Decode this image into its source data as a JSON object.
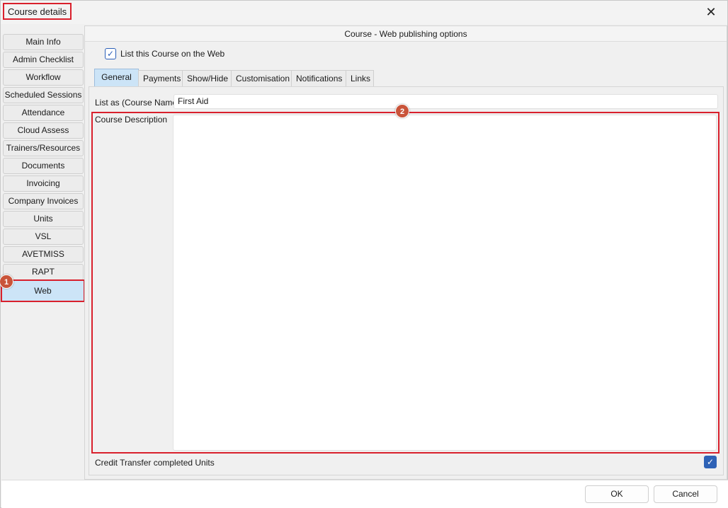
{
  "window": {
    "title": "Course details",
    "close_icon": "close-icon",
    "close_glyph": "✕"
  },
  "sidebar": {
    "items": [
      {
        "label": "Main Info"
      },
      {
        "label": "Admin Checklist"
      },
      {
        "label": "Workflow"
      },
      {
        "label": "Scheduled Sessions"
      },
      {
        "label": "Attendance"
      },
      {
        "label": "Cloud Assess"
      },
      {
        "label": "Trainers/Resources"
      },
      {
        "label": "Documents"
      },
      {
        "label": "Invoicing"
      },
      {
        "label": "Company Invoices"
      },
      {
        "label": "Units"
      },
      {
        "label": "VSL"
      },
      {
        "label": "AVETMISS"
      },
      {
        "label": "RAPT"
      },
      {
        "label": "Web",
        "active": true
      }
    ]
  },
  "markers": {
    "one": "1",
    "two": "2"
  },
  "panel": {
    "title": "Course - Web publishing options",
    "list_on_web_label": "List this Course on the Web",
    "list_on_web_checked": true,
    "check_glyph": "✓"
  },
  "tabs": [
    {
      "label": "General",
      "active": true
    },
    {
      "label": "Payments"
    },
    {
      "label": "Show/Hide"
    },
    {
      "label": "Customisation"
    },
    {
      "label": "Notifications"
    },
    {
      "label": "Links"
    }
  ],
  "general": {
    "list_as_label": "List as (Course Name)",
    "list_as_value": "First Aid",
    "description_label": "Course Description",
    "description_value": "",
    "credit_transfer_label": "Credit Transfer completed Units",
    "credit_transfer_checked": true
  },
  "footer": {
    "ok_label": "OK",
    "cancel_label": "Cancel"
  },
  "colors": {
    "highlight": "#d9202c",
    "marker": "#c9543a",
    "active_tab": "#cce4f7",
    "checkbox_accent": "#2e62b6"
  }
}
